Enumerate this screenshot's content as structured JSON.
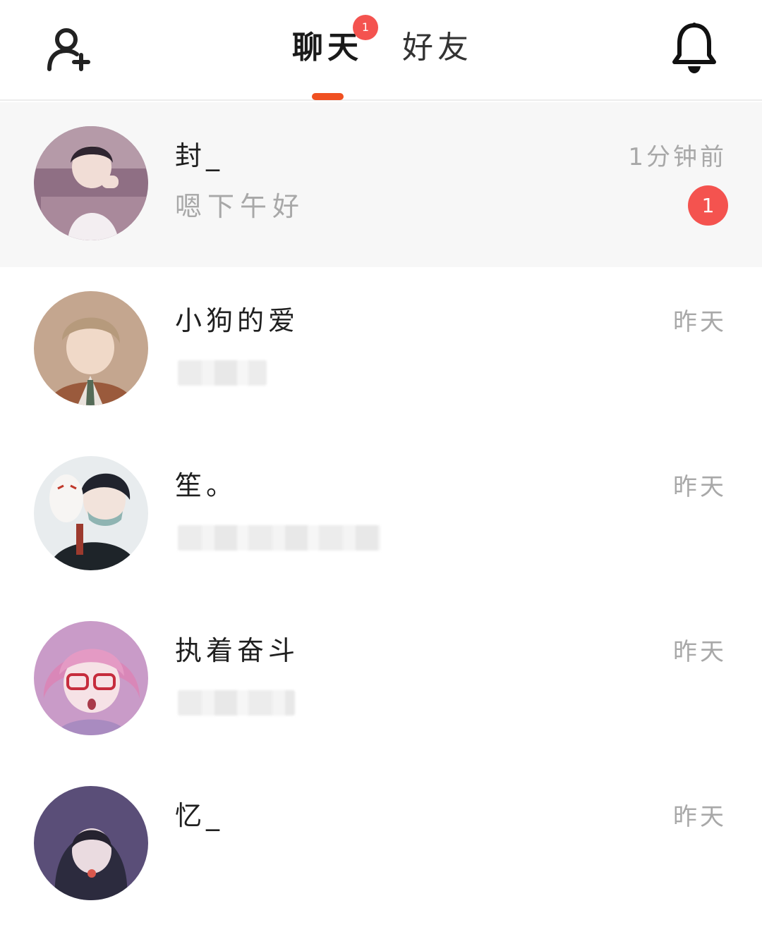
{
  "header": {
    "add_friend_icon": "user-plus-icon",
    "notification_icon": "bell-icon",
    "tabs": [
      {
        "label": "聊天",
        "badge": "1",
        "active": true
      },
      {
        "label": "好友",
        "active": false
      }
    ],
    "accent_color": "#f05021",
    "badge_color": "#f4534f"
  },
  "conversations": [
    {
      "name": "封_",
      "time": "1分钟前",
      "preview": "嗯下午好",
      "unread": "1",
      "active": true
    },
    {
      "name": "小狗的爱",
      "time": "昨天",
      "preview_blurred": true
    },
    {
      "name": "笙。",
      "time": "昨天",
      "preview_blurred": true
    },
    {
      "name": "执着奋斗",
      "time": "昨天",
      "preview_blurred": true
    },
    {
      "name": "忆_",
      "time": "昨天",
      "preview_blurred": true
    }
  ]
}
